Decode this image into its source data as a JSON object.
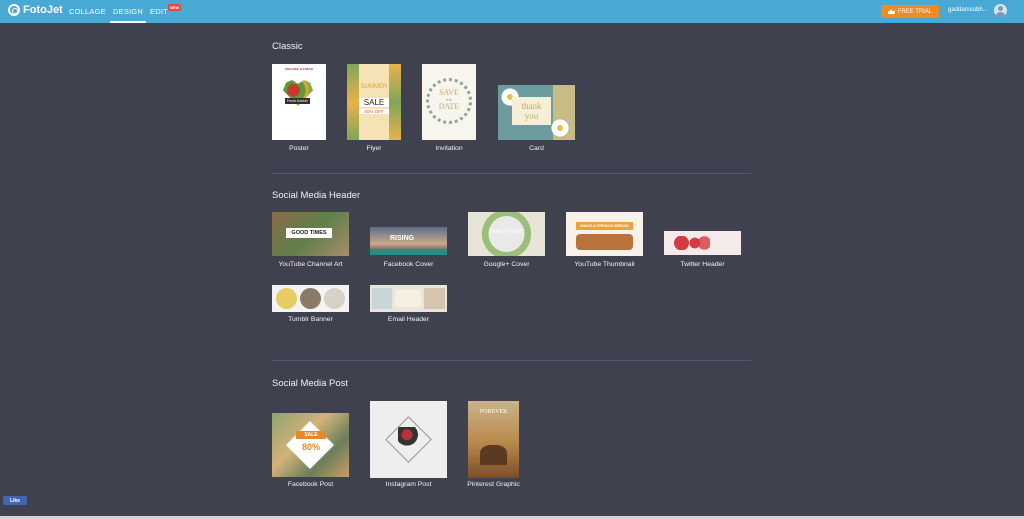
{
  "header": {
    "logo_text": "FotoJet",
    "nav": [
      "COLLAGE",
      "DESIGN",
      "EDIT"
    ],
    "new_badge": "NEW",
    "free_trial": "FREE TRIAL",
    "username": "gaddamsubh..."
  },
  "sections": [
    {
      "title": "Classic",
      "items": [
        {
          "label": "Poster"
        },
        {
          "label": "Flyer"
        },
        {
          "label": "Invitation"
        },
        {
          "label": "Card"
        }
      ]
    },
    {
      "title": "Social Media Header",
      "items": [
        {
          "label": "YouTube Channel Art"
        },
        {
          "label": "Facebook Cover"
        },
        {
          "label": "Google+ Cover"
        },
        {
          "label": "YouTube Thumbnail"
        },
        {
          "label": "Twitter Header"
        },
        {
          "label": "Tumblr Banner"
        },
        {
          "label": "Email Header"
        }
      ]
    },
    {
      "title": "Social Media Post",
      "items": [
        {
          "label": "Facebook Post"
        },
        {
          "label": "Instagram Post"
        },
        {
          "label": "Pinterest Graphic"
        }
      ]
    }
  ],
  "thumbnail_text": {
    "poster_top": "ORGANIC & FRESH",
    "poster_badge": "Fresh Market",
    "flyer_big": "SUMMER",
    "flyer_sale": "SALE",
    "flyer_pct": "50% OFF",
    "invite_save": "SAVE",
    "invite_the": "the",
    "invite_date": "DATE",
    "card_thank": "thank",
    "card_you": "you",
    "yt_art": "GOOD TIMES",
    "fb_cover": "RISING",
    "gplus": "SWEET HEART",
    "yt_thumb": "MAKE A FRENCH BREAD",
    "fb_post_sale": "SALE",
    "fb_post_pct": "80%",
    "pin_title": "FOREVER"
  },
  "like_button": "Like",
  "colors": {
    "topbar": "#48a9d4",
    "background": "#3f424e",
    "free_trial": "#f08a24",
    "new_badge": "#e34b3c"
  }
}
